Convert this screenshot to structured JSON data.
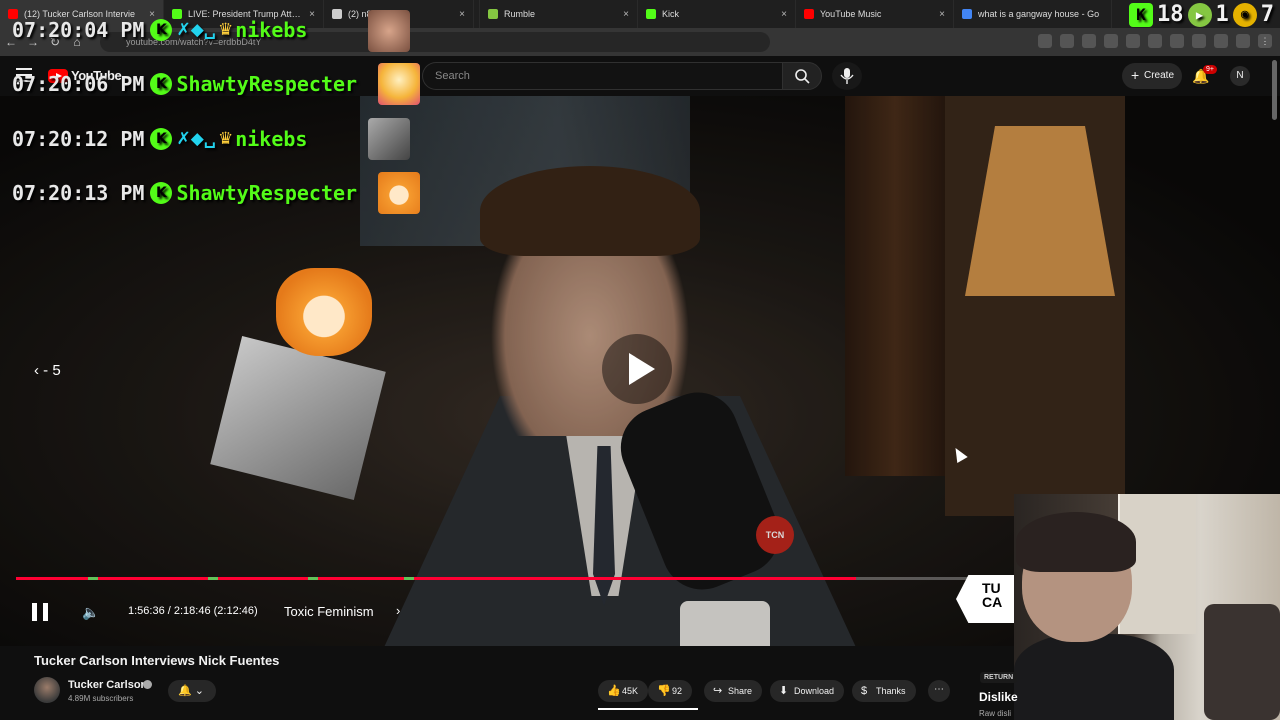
{
  "browser": {
    "tabs": [
      {
        "label": "(12) Tucker Carlson Intervie",
        "color": "#ff0000",
        "active": true
      },
      {
        "label": "LIVE: President Trump Attends",
        "color": "#53fc18",
        "active": false
      },
      {
        "label": "(2) n8",
        "color": "#cccccc",
        "active": false
      },
      {
        "label": "",
        "color": "#222222",
        "active": false
      },
      {
        "label": "Rumble",
        "color": "#85c742",
        "active": false
      },
      {
        "label": "Kick",
        "color": "#53fc18",
        "active": false
      },
      {
        "label": "YouTube Music",
        "color": "#ff0000",
        "active": false
      },
      {
        "label": "what is a gangway house - Go",
        "color": "#4285f4",
        "active": false
      }
    ],
    "address": "youtube.com/watch?v=erdbbD4tY",
    "tab_close_glyph": "×"
  },
  "overlay": {
    "top_line": {
      "time": "07:20:04 PM",
      "badges": "✗◆␣",
      "crown": "♛",
      "user": "nikebs"
    },
    "counters": {
      "kick": "18",
      "rumble": "1",
      "other": "7"
    },
    "chat": [
      {
        "time": "07:20:06 PM",
        "user": "ShawtyRespecter",
        "badges": "",
        "crown": ""
      },
      {
        "time": "07:20:12 PM",
        "user": "nikebs",
        "badges": "✗◆␣",
        "crown": "♛"
      },
      {
        "time": "07:20:13 PM",
        "user": "ShawtyRespecter",
        "badges": "",
        "crown": ""
      }
    ],
    "kick_glyph": "K",
    "corner_sticker": "TU\nCA"
  },
  "youtube": {
    "logo_text": "YouTube",
    "search_placeholder": "Search",
    "create_label": "Create",
    "notif_badge": "9+",
    "account_initial": "N"
  },
  "player": {
    "seek_back": "- 5",
    "current_time": "1:56:36 / 2:18:46 (2:12:46)",
    "chapter": "Toxic Feminism",
    "progress_fraction": 0.84,
    "mic_brand": "TCN"
  },
  "video": {
    "title": "Tucker Carlson Interviews Nick Fuentes",
    "channel": "Tucker Carlson",
    "subscribers": "4.89M subscribers",
    "likes": "45K",
    "dislikes": "92",
    "share": "Share",
    "download": "Download",
    "thanks": "Thanks",
    "ryd_tag": "RETURN",
    "ryd_title": "Dislike",
    "ryd_sub": "Raw disli"
  }
}
